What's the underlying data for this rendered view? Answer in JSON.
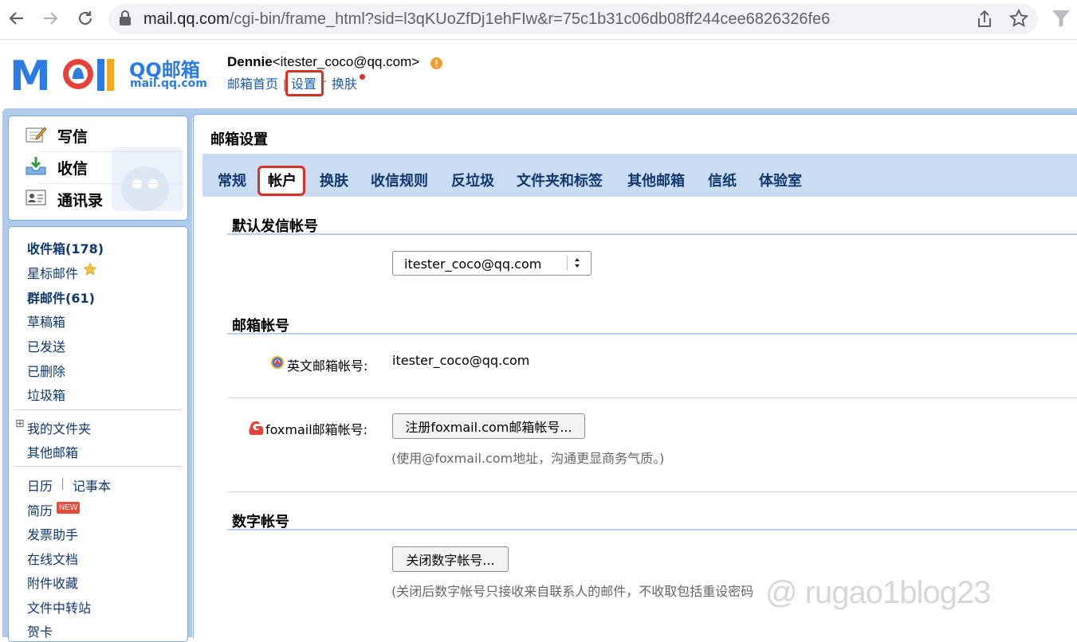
{
  "browser": {
    "url_domain": "mail.qq.com",
    "url_path": "/cgi-bin/frame_html?sid=l3qKUoZfDj1ehFIw&r=75c1b31c06db08ff244cee6826326fe6"
  },
  "header": {
    "logo_text": "QQ邮箱",
    "logo_sub": "mail.qq.com",
    "user_name": "Dennie",
    "user_email": "<itester_coco@qq.com>",
    "links": {
      "home": "邮箱首页",
      "settings": "设置",
      "skin": "换肤"
    },
    "sep_bar": "|",
    "sep_dash": "-"
  },
  "quick_actions": [
    {
      "label": "写信",
      "icon": "compose-icon"
    },
    {
      "label": "收信",
      "icon": "inbox-download-icon"
    },
    {
      "label": "通讯录",
      "icon": "contacts-icon"
    }
  ],
  "folders": {
    "inbox": "收件箱(178)",
    "starred": "星标邮件",
    "group": "群邮件(61)",
    "drafts": "草稿箱",
    "sent": "已发送",
    "deleted": "已删除",
    "trash": "垃圾箱",
    "my_folders": "我的文件夹",
    "other_mail": "其他邮箱",
    "calendar": "日历",
    "notes": "记事本",
    "resume": "简历",
    "resume_badge": "NEW",
    "invoice": "发票助手",
    "online_docs": "在线文档",
    "attachments": "附件收藏",
    "transfer": "文件中转站",
    "cards": "贺卡",
    "expand_glyph": "⊞",
    "pipe": "|"
  },
  "main": {
    "title": "邮箱设置",
    "tabs": [
      "常规",
      "帐户",
      "换肤",
      "收信规则",
      "反垃圾",
      "文件夹和标签",
      "其他邮箱",
      "信纸",
      "体验室"
    ],
    "active_tab": "帐户",
    "default_sender": {
      "title": "默认发信帐号",
      "select_value": "itester_coco@qq.com"
    },
    "mail_account": {
      "title": "邮箱帐号",
      "english_label": "英文邮箱帐号:",
      "english_value": "itester_coco@qq.com",
      "foxmail_label": "foxmail邮箱帐号:",
      "foxmail_button": "注册foxmail.com邮箱帐号...",
      "foxmail_hint": "(使用@foxmail.com地址，沟通更显商务气质。)"
    },
    "digital_account": {
      "title": "数字帐号",
      "close_button": "关闭数字帐号...",
      "hint": "(关闭后数字帐号只接收来自联系人的邮件，不收取包括重设密码"
    }
  },
  "watermark": "@ rugao1blog23",
  "colors": {
    "link": "#1a5bb3",
    "frame": "#aecbeb",
    "tab_strip": "#c9dcf2",
    "highlight_box": "#d93025",
    "folder_text": "#10376e",
    "new_badge": "#e44d3a"
  }
}
